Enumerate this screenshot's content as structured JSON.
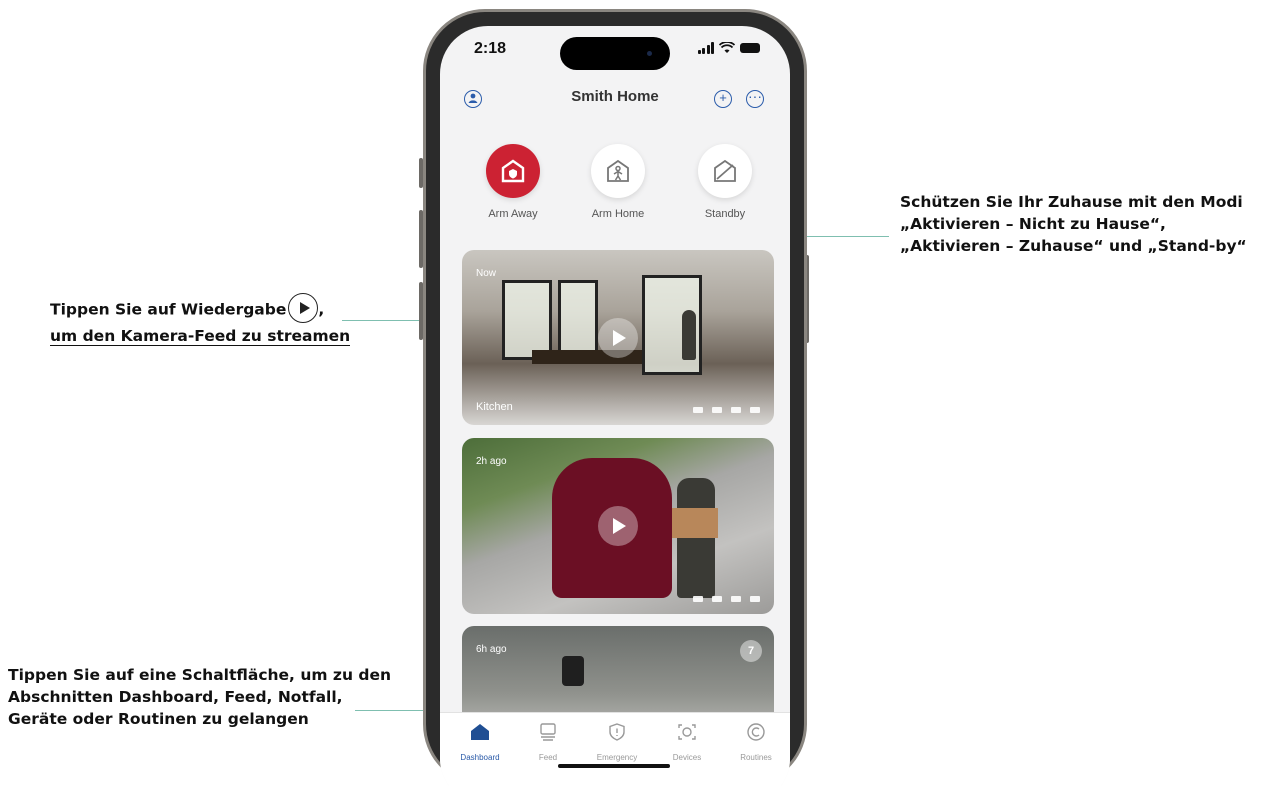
{
  "annotations": {
    "play_line1": "Tippen Sie auf Wiedergabe",
    "play_comma": ",",
    "play_line2": "um den Kamera-Feed zu streamen",
    "modes_line1": "Schützen Sie Ihr Zuhause mit den Modi",
    "modes_line2": "„Aktivieren – Nicht zu Hause“,",
    "modes_line3": "„Aktivieren – Zuhause“ und „Stand-by“",
    "nav_line1": "Tippen Sie auf eine Schaltfläche, um zu den",
    "nav_line2": "Abschnitten Dashboard, Feed, Notfall,",
    "nav_line3": "Geräte oder Routinen zu gelangen"
  },
  "status_bar": {
    "time": "2:18"
  },
  "header": {
    "title": "Smith Home"
  },
  "modes": [
    {
      "label": "Arm Away",
      "active": true
    },
    {
      "label": "Arm Home",
      "active": false
    },
    {
      "label": "Standby",
      "active": false
    }
  ],
  "cameras": [
    {
      "time": "Now",
      "name": "Kitchen"
    },
    {
      "time": "2h ago",
      "name": ""
    },
    {
      "time": "6h ago",
      "name": "",
      "badge": "7"
    }
  ],
  "tabs": [
    {
      "label": "Dashboard",
      "icon": "home-icon",
      "active": true
    },
    {
      "label": "Feed",
      "icon": "feed-icon",
      "active": false
    },
    {
      "label": "Emergency",
      "icon": "shield-icon",
      "active": false
    },
    {
      "label": "Devices",
      "icon": "devices-icon",
      "active": false
    },
    {
      "label": "Routines",
      "icon": "routines-icon",
      "active": false
    }
  ],
  "colors": {
    "accent": "#2a5aa8",
    "arm_away": "#cc2233",
    "callout_line": "#7fbfb0"
  }
}
